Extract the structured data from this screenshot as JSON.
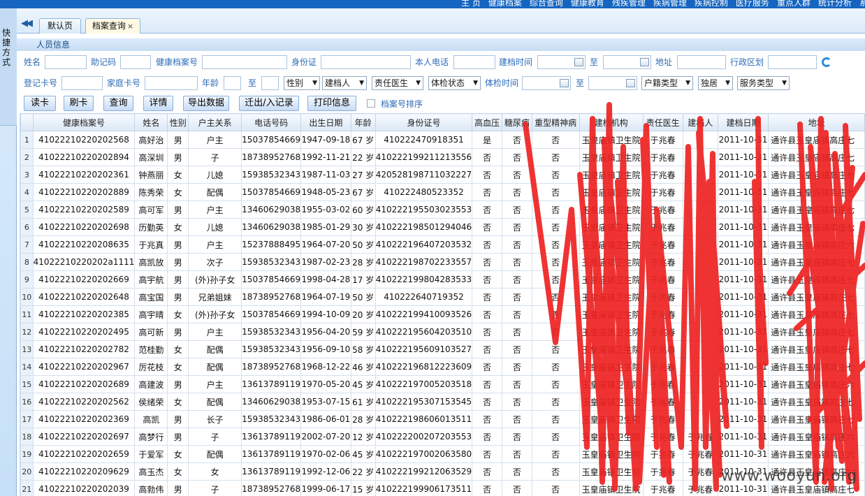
{
  "top_nav": [
    "主 页",
    "健康档案",
    "综合查询",
    "健康教育",
    "残疾管理",
    "疾病管理",
    "疾病控制",
    "医疗服务",
    "重点人群",
    "统计分析",
    "系"
  ],
  "sidebar_title": "快捷方式",
  "tabs": [
    {
      "label": "默认页"
    },
    {
      "label": "档案查询",
      "close": "×"
    }
  ],
  "panel_title": "人员信息",
  "search": {
    "row1": [
      "姓名",
      "助记码",
      "健康档案号",
      "身份证",
      "本人电话",
      "建档时间",
      "至",
      "地址",
      "行政区划"
    ],
    "row2": [
      "登记卡号",
      "家庭卡号",
      "年龄",
      "至",
      "体检时间",
      "至"
    ],
    "selects": [
      "性别",
      "建档人",
      "责任医生",
      "体检状态",
      "户籍类型",
      "独居",
      "服务类型"
    ]
  },
  "buttons": [
    "读卡",
    "刷卡",
    "查询",
    "详情",
    "导出数据",
    "迁出/入记录",
    "打印信息"
  ],
  "sort_label": "档案号排序",
  "columns": [
    "",
    "健康档案号",
    "姓名",
    "性别",
    "户主关系",
    "电话号码",
    "出生日期",
    "年龄",
    "身份证号",
    "高血压",
    "糖尿病",
    "重型精神病",
    "建档机构",
    "责任医生",
    "建档人",
    "建档日期",
    "地址"
  ],
  "rows": [
    [
      "1",
      "41022210220202568",
      "高好治",
      "男",
      "户主",
      "15037854669",
      "1947-09-18",
      "67 岁",
      "410222470918351",
      "是",
      "否",
      "否",
      "玉皇庙镇卫生院",
      "于兆春",
      "",
      "2011-10-31",
      "通许县玉皇庙镇高庄七"
    ],
    [
      "2",
      "41022210220202894",
      "高深圳",
      "男",
      "子",
      "18738952768",
      "1992-11-21",
      "22 岁",
      "410222199211213556",
      "否",
      "否",
      "否",
      "玉皇庙镇卫生院",
      "于兆春",
      "",
      "2011-10-31",
      "通许县玉皇庙镇高庄七"
    ],
    [
      "3",
      "41022210220202361",
      "钟燕丽",
      "女",
      "儿媳",
      "15938532343",
      "1987-11-03",
      "27 岁",
      "420528198711032227",
      "否",
      "否",
      "否",
      "玉皇庙镇卫生院",
      "于兆春",
      "",
      "2011-10-31",
      "通许县玉皇庙镇高庄七"
    ],
    [
      "4",
      "41022210220202889",
      "陈秀荣",
      "女",
      "配偶",
      "15037854669",
      "1948-05-23",
      "67 岁",
      "410222480523352",
      "否",
      "否",
      "否",
      "玉皇庙镇卫生院",
      "于兆春",
      "",
      "2011-10-31",
      "通许县玉皇庙镇高庄七"
    ],
    [
      "5",
      "41022210220202589",
      "高可军",
      "男",
      "户主",
      "13460629038",
      "1955-03-02",
      "60 岁",
      "410222195503023553",
      "否",
      "否",
      "否",
      "玉皇庙镇卫生院",
      "于兆春",
      "",
      "2011-10-31",
      "通许县玉皇庙镇高庄七"
    ],
    [
      "6",
      "41022210220202698",
      "历勤英",
      "女",
      "儿媳",
      "13460629038",
      "1985-01-29",
      "30 岁",
      "410222198501294046",
      "否",
      "否",
      "否",
      "玉皇庙镇卫生院",
      "于兆春",
      "",
      "2011-10-31",
      "通许县玉皇庙镇高庄七"
    ],
    [
      "7",
      "41022210220208635",
      "于兆真",
      "男",
      "户主",
      "15237888495",
      "1964-07-20",
      "50 岁",
      "410222196407203532",
      "否",
      "否",
      "否",
      "玉皇庙镇卫生院",
      "于兆春",
      "",
      "2011-10-31",
      "通许县玉皇庙镇高庄六"
    ],
    [
      "8",
      "41022210220202a1111",
      "高凯放",
      "男",
      "次子",
      "15938532343",
      "1987-02-23",
      "28 岁",
      "410222198702233557",
      "否",
      "否",
      "否",
      "玉皇庙镇卫生院",
      "于兆春",
      "",
      "2011-10-31",
      "通许县玉皇庙镇高庄七"
    ],
    [
      "9",
      "41022210220202669",
      "高宇航",
      "男",
      "(外)孙子女",
      "15037854669",
      "1998-04-28",
      "17 岁",
      "410222199804283533",
      "否",
      "否",
      "否",
      "玉皇庙镇卫生院",
      "于兆春",
      "",
      "2011-10-31",
      "通许县玉皇庙镇高庄七"
    ],
    [
      "10",
      "41022210220202648",
      "高宝国",
      "男",
      "兄弟姐妹",
      "18738952768",
      "1964-07-19",
      "50 岁",
      "41022264071935​2",
      "否",
      "否",
      "否",
      "玉皇庙镇卫生院",
      "于兆春",
      "",
      "2011-10-31",
      "通许县玉皇庙镇高庄七"
    ],
    [
      "11",
      "41022210220202385",
      "高宇晴",
      "女",
      "(外)孙子女",
      "15037854669",
      "1994-10-09",
      "20 岁",
      "410222199410093526",
      "否",
      "否",
      "否",
      "玉皇庙镇卫生院",
      "于兆春",
      "",
      "2011-10-31",
      "通许县玉皇庙镇高庄七"
    ],
    [
      "12",
      "41022210220202495",
      "高可新",
      "男",
      "户主",
      "15938532343",
      "1956-04-20",
      "59 岁",
      "410222195604203510",
      "否",
      "否",
      "否",
      "玉皇庙镇卫生院",
      "于兆春",
      "",
      "2011-10-31",
      "通许县玉皇庙镇高庄七"
    ],
    [
      "13",
      "41022210220202782",
      "范桂勤",
      "女",
      "配偶",
      "15938532343",
      "1956-09-10",
      "58 岁",
      "410222195609103527",
      "否",
      "否",
      "否",
      "玉皇庙镇卫生院",
      "于兆春",
      "",
      "2011-10-31",
      "通许县玉皇庙镇高庄七"
    ],
    [
      "14",
      "41022210220202967",
      "厉花枝",
      "女",
      "配偶",
      "18738952768",
      "1968-12-22",
      "46 岁",
      "410222196812223609",
      "否",
      "否",
      "否",
      "玉皇庙镇卫生院",
      "于兆春",
      "",
      "2011-10-31",
      "通许县玉皇庙镇高庄七"
    ],
    [
      "15",
      "41022210220202689",
      "高建波",
      "男",
      "户主",
      "13613789119",
      "1970-05-20",
      "45 岁",
      "410222197005203518",
      "否",
      "否",
      "否",
      "玉皇庙镇卫生院",
      "于兆春",
      "",
      "2011-10-31",
      "通许县玉皇庙镇高庄六"
    ],
    [
      "16",
      "41022210220202562",
      "侯绪荣",
      "女",
      "配偶",
      "13460629038",
      "1953-07-15",
      "61 岁",
      "410222195307153545",
      "否",
      "否",
      "否",
      "玉皇庙镇卫生院",
      "于兆春",
      "",
      "2011-10-31",
      "通许县玉皇庙镇高庄七"
    ],
    [
      "17",
      "41022210220202369",
      "高凯",
      "男",
      "长子",
      "15938532343",
      "1986-06-01",
      "28 岁",
      "410222198606013511",
      "否",
      "否",
      "否",
      "玉皇庙镇卫生院",
      "于兆春",
      "",
      "2011-10-31",
      "通许县玉皇庙镇高庄七"
    ],
    [
      "18",
      "41022210220202697",
      "高梦行",
      "男",
      "子",
      "13613789119",
      "2002-07-20",
      "12 岁",
      "410222200207203553",
      "否",
      "否",
      "否",
      "玉皇庙镇卫生院",
      "于兆春",
      "于兆春",
      "2011-10-31",
      "通许县玉皇庙镇高庄六"
    ],
    [
      "19",
      "41022210220202659",
      "于爱军",
      "女",
      "配偶",
      "13613789119",
      "1970-02-06",
      "45 岁",
      "410222197002063580",
      "否",
      "否",
      "否",
      "玉皇庙镇卫生院",
      "于兆春",
      "于兆春",
      "2011-10-31",
      "通许县玉皇庙镇高庄六"
    ],
    [
      "20",
      "41022210220209629",
      "高玉杰",
      "女",
      "女",
      "13613789119",
      "1992-12-06",
      "22 岁",
      "410222199212063529",
      "否",
      "否",
      "否",
      "玉皇庙镇卫生院",
      "于兆春",
      "于兆春",
      "2011-10-31",
      "通许县玉皇庙镇高庄六"
    ],
    [
      "21",
      "41022210220202039",
      "高勃伟",
      "男",
      "子",
      "18738952768",
      "1999-06-17",
      "15 岁",
      "410222199906173511",
      "否",
      "否",
      "否",
      "玉皇庙镇卫生院",
      "于兆春",
      "于兆春",
      "2011-10-31",
      "通许县玉皇庙镇高庄七"
    ]
  ],
  "watermark": "www.wooyun.org",
  "colors": {
    "accent": "#1565c0",
    "label": "#2d6bb8",
    "scribble": "#ee2222"
  }
}
